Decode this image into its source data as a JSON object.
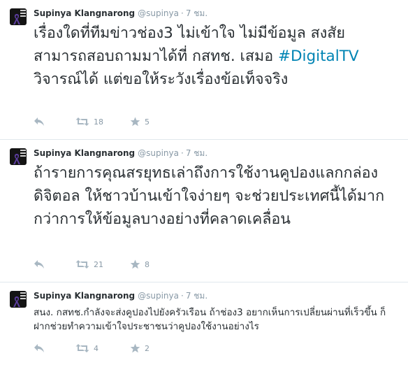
{
  "tweets": [
    {
      "name": "Supinya Klangnarong",
      "handle": "@supinya",
      "separator": "·",
      "time": "7 ชม.",
      "text_before": "เรื่องใดที่ทีมข่าวช่อง3 ไม่เข้าใจ ไม่มีข้อมูล สงสัย สามารถสอบถามมาได้ที่ กสทช. เสมอ ",
      "hashtag": "#DigitalTV",
      "text_after": " วิจารณ์ได้ แต่ขอให้ระวังเรื่องข้อเท็จจริง",
      "retweets": "18",
      "favorites": "5"
    },
    {
      "name": "Supinya Klangnarong",
      "handle": "@supinya",
      "separator": "·",
      "time": "7 ชม.",
      "text": "ถ้ารายการคุณสรยุทธเล่าถึงการใช้งานคูปองแลกกล่องดิจิตอล ให้ชาวบ้านเข้าใจง่ายๆ จะช่วยประเทศนี้ได้มาก กว่าการให้ข้อมูลบางอย่างที่คลาดเคลื่อน",
      "retweets": "21",
      "favorites": "8"
    },
    {
      "name": "Supinya Klangnarong",
      "handle": "@supinya",
      "separator": "·",
      "time": "7 ชม.",
      "text": "สนง. กสทช.กำลังจะส่งคูปองไปยังครัวเรือน ถ้าช่อง3 อยากเห็นการเปลี่ยนผ่านที่เร็วขึ้น ก็ฝากช่วยทำความเข้าใจประชาชนว่าคูปองใช้งานอย่างไร",
      "retweets": "4",
      "favorites": "2"
    }
  ],
  "icons": {
    "reply": "reply-icon",
    "retweet": "retweet-icon",
    "favorite": "star-icon",
    "avatar": "purple-ribbon-avatar"
  },
  "colors": {
    "hashtag": "#0084b4",
    "meta": "#8899a6",
    "text": "#292f33",
    "divider": "#e1e8ed",
    "ribbon": "#5b3d9e"
  }
}
